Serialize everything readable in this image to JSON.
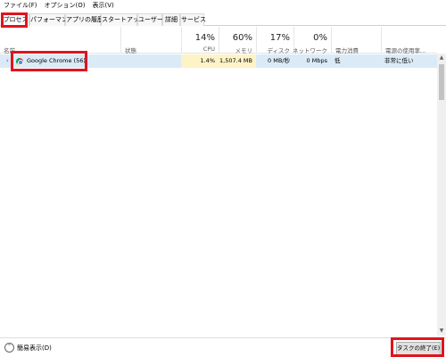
{
  "menu": [
    "ファイル(F)",
    "オプション(O)",
    "表示(V)"
  ],
  "tabs": [
    "プロセス",
    "パフォーマンス",
    "アプリの履歴",
    "スタートアップ",
    "ユーザー",
    "詳細",
    "サービス"
  ],
  "columns": {
    "name": "名前",
    "status": "状態",
    "cpu": {
      "pct": "14%",
      "label": "CPU"
    },
    "memory": {
      "pct": "60%",
      "label": "メモリ"
    },
    "disk": {
      "pct": "17%",
      "label": "ディスク"
    },
    "network": {
      "pct": "0%",
      "label": "ネットワーク"
    },
    "power": "電力消費",
    "power_trend": "電源の使用率..."
  },
  "process": {
    "name": "Google Chrome (56)",
    "status": "",
    "cpu": "1.4%",
    "memory": "1,507.4 MB",
    "disk": "0 MB/秒",
    "network": "0 Mbps",
    "power": "低",
    "power_trend": "非常に低い"
  },
  "footer": {
    "details_toggle": "簡易表示(D)",
    "end_task": "タスクの終了(E)"
  },
  "icons": {
    "expand": "chevron-right-icon",
    "app": "chrome-icon",
    "collapse": "chevron-up-icon"
  },
  "colors": {
    "highlight": "#e0141e",
    "selected_row": "#dbeaf7",
    "heat_cell": "#fdf3c6"
  }
}
